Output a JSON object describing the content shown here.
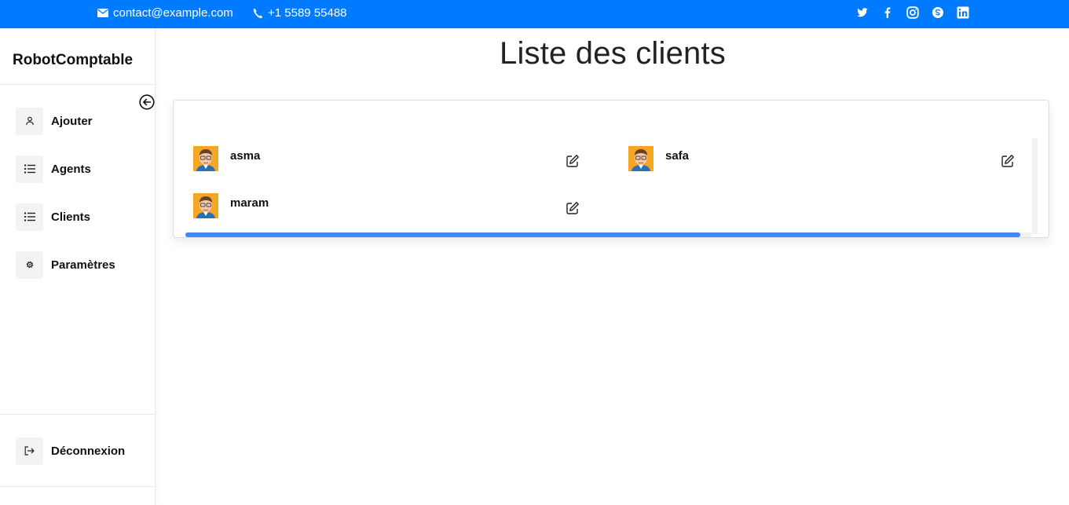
{
  "topbar": {
    "email": "contact@example.com",
    "phone": "+1 5589 55488",
    "social": [
      "twitter-icon",
      "facebook-icon",
      "instagram-icon",
      "skype-icon",
      "linkedin-icon"
    ]
  },
  "sidebar": {
    "brand": "RobotComptable",
    "items": [
      {
        "label": "Ajouter",
        "icon": "user-icon"
      },
      {
        "label": "Agents",
        "icon": "list-icon"
      },
      {
        "label": "Clients",
        "icon": "list-icon"
      },
      {
        "label": "Paramètres",
        "icon": "gear-icon"
      }
    ],
    "logout": {
      "label": "Déconnexion",
      "icon": "logout-icon"
    }
  },
  "main": {
    "title": "Liste des clients",
    "clients": [
      {
        "name": "asma"
      },
      {
        "name": "safa"
      },
      {
        "name": "maram"
      }
    ]
  },
  "colors": {
    "primary": "#007bff",
    "scrollbar": "#4285f4"
  }
}
